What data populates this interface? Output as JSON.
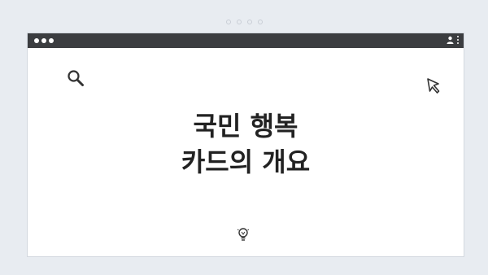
{
  "headline": {
    "line1": "국민 행복",
    "line2": "카드의 개요"
  },
  "icons": {
    "search": "search-icon",
    "cursor": "cursor-icon",
    "lightbulb": "lightbulb-icon",
    "profile": "profile-icon",
    "menu": "kebab-menu-icon"
  },
  "colors": {
    "page_background": "#e8ecf1",
    "titlebar": "#3b3d40",
    "window_background": "#ffffff",
    "text": "#222222"
  }
}
